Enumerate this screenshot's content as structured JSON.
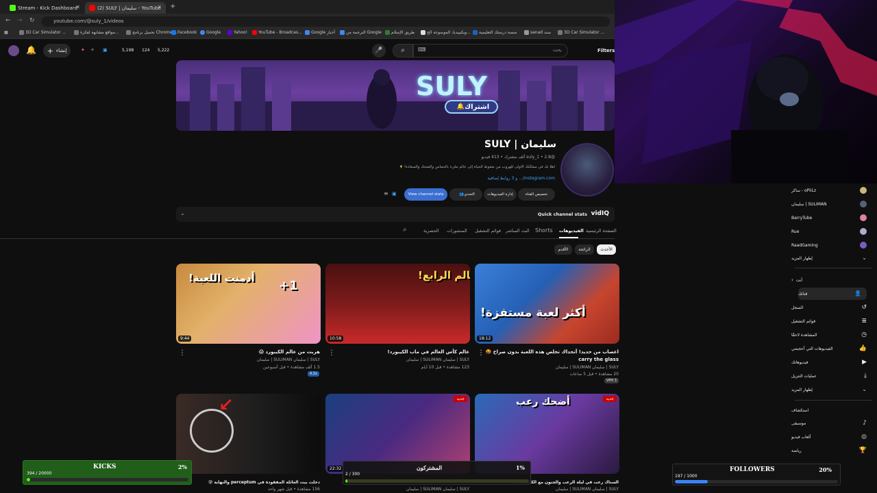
{
  "browser": {
    "tabs": [
      {
        "title": "Stream - Kick Dashboard",
        "active": false
      },
      {
        "title": "(2) SULY | سليمان - YouTube",
        "active": true
      }
    ],
    "url": "youtube.com/@suly_1/videos",
    "bookmarks": [
      "3D Car Simulator ...",
      "مواقع مشابهة لفكرة...",
      "تحميل برنامج Chrome ...",
      "Facebook",
      "Google",
      "Yahoo!",
      "YouTube - Broadcas...",
      "Google أخبار",
      "الترجمة من Google",
      "طريق الإسلام",
      "ويكيبيديا، الموسوعة الح...",
      "منصة درستك التعليمية",
      "sanad سند",
      "3D Car Simulator ..."
    ]
  },
  "topbar": {
    "create_label": "إنشاء",
    "stats": {
      "a": "5,198",
      "b": "124",
      "c": "5,222"
    },
    "search_placeholder": "بحث",
    "filters_label": "Filters"
  },
  "banner": {
    "title": "SULY",
    "subscribe_label": "اشتراك"
  },
  "channel": {
    "name": "سليمان | SULY",
    "meta": "@suly_1 • 2.8 ألف مشترك • 413 فيديو",
    "description": "أهلاً بك في مملكتك الأولى للهروب من ضغوط الحياة إلى عالم مليء بالحماس والضحك والسعادة! ✨ __المزيد",
    "links": "instagram.com/... و 3 روابط إضافية",
    "buttons": {
      "customize": "تخصيص القناة",
      "manage": "إدارة الفيديوهات",
      "studio": "التحدي",
      "stats": "View channel stats"
    }
  },
  "vidiq": {
    "label": "Quick channel stats",
    "brand": "vidIQ"
  },
  "tabs": [
    "الصفحة الرئيسية",
    "الفيديوهات",
    "Shorts",
    "البث المباشر",
    "قوائم التشغيل",
    "المنشورات",
    "الحصرية"
  ],
  "active_tab": "الفيديوهات",
  "sort": [
    "الأحدث",
    "الرائجة",
    "الأقدم"
  ],
  "videos": [
    {
      "title": "اعصاب من حديد! أتحداك تخلص هذه اللعبة بدون صراخ 🤬 carry the glass",
      "channel": "SULY | سليمان SULIMAN | سليمان",
      "meta": "20 مشاهدة • قبل 5 ساعات",
      "badge": "VPH 3",
      "duration": "18:12",
      "thumb_text": "أكثر لعبة مستفزة!"
    },
    {
      "title": "عالم كأس العالم في ماب الكيبورد!",
      "channel": "SULY | سليمان SULIMAN | سليمان",
      "meta": "123 مشاهدة • قبل 10 أيام",
      "badge": "",
      "duration": "10:58",
      "thumb_text": "العالم الرابع!"
    },
    {
      "title": "هربت من عالم الكيبورد 😱",
      "channel": "SULY | سليمان SULIMAN | سليمان",
      "meta": "1.5 ألف مشاهدة • قبل أسبوعين",
      "badge": "4.2x",
      "duration": "9:44",
      "thumb_text": "أدمنت اللعبة!"
    },
    {
      "title": "السناك رعب في ليلة الرعب والجنون مع الكائنات ...",
      "channel": "SULY | سليمان SULIMAN | سليمان",
      "meta": "",
      "badge": "",
      "duration": "",
      "thumb_text": "أضحك رعب",
      "new": "جديد"
    },
    {
      "title": "",
      "channel": "SULY | سليمان SULIMAN | سليمان",
      "meta": "",
      "badge": "",
      "duration": "22:32",
      "thumb_text": "",
      "new": "جديد"
    },
    {
      "title": "دخلت بيت العائلة المفقودة في perceptum والنهاية 😰",
      "channel": "SULY | سليمان SULIMAN | سليمان",
      "meta": "156 مشاهدة • قبل شهر واحد",
      "badge": "",
      "duration": "",
      "thumb_text": ""
    }
  ],
  "sidebar": {
    "subscriptions": [
      "oPiiLz - ساكر",
      "SULIMAN | سليمان",
      "BarryTube",
      "Rue",
      "RaadGaming"
    ],
    "show_more": "إظهار المزيد",
    "you_header": "أنت",
    "you_items": [
      "قناتك",
      "السجل",
      "قوائم التشغيل",
      "المشاهدة لاحقًا",
      "الفيديوهات التي أعجبتني",
      "فيديوهاتك",
      "عمليات التنزيل",
      "إظهار المزيد"
    ],
    "explore_header": "استكشاف",
    "explore_items": [
      "موسيقى",
      "ألعاب فيديو",
      "رياضة"
    ]
  },
  "goals": {
    "kicks": {
      "label": "KICKS",
      "percent": "2%",
      "progress": "394 / 20000",
      "fill": 0.02,
      "color": "#53fc18"
    },
    "subs": {
      "label": "المشتركون",
      "percent": "1%",
      "progress": "2 / 300",
      "fill": 0.01,
      "color": "#53fc18"
    },
    "followers": {
      "label": "FOLLOWERS",
      "percent": "20%",
      "progress": "197 / 1000",
      "fill": 0.2,
      "color": "#3b82f6"
    }
  },
  "colors": {
    "accent": "#3ea6ff",
    "yt_red": "#ff0000",
    "kick_green": "#53fc18"
  }
}
